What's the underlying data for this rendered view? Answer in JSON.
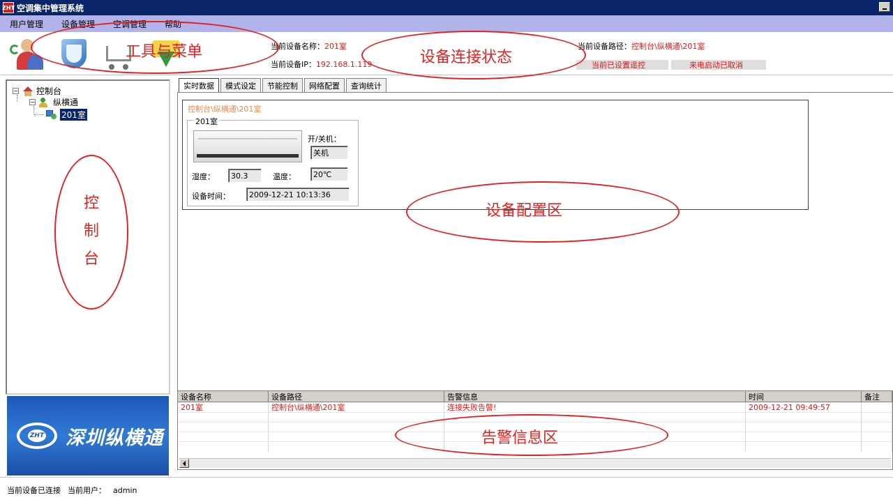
{
  "window": {
    "title": "空调集中管理系统",
    "icon_text": "ZHT"
  },
  "menu": [
    "用户管理",
    "设备管理",
    "空调管理",
    "帮助"
  ],
  "toolbar": {
    "icons": [
      "users-icon",
      "shield-icon",
      "cart-icon",
      "download-icon"
    ]
  },
  "device_info": {
    "name_label": "当前设备名称：",
    "name_value": "201室",
    "ip_label": "当前设备IP：",
    "ip_value": "192.168.1.119",
    "path_label": "当前设备路径：",
    "path_value": "控制台\\纵横通\\201室",
    "status_remote": "当前已设置遥控",
    "status_autostart": "来电启动已取消"
  },
  "tree": {
    "root": "控制台",
    "child": "纵横通",
    "leaf": "201室"
  },
  "logo": {
    "mark_text": "ZHT",
    "text": "深圳纵横通"
  },
  "tabs": [
    "实时数据",
    "模式设定",
    "节能控制",
    "网络配置",
    "查询统计"
  ],
  "device_panel": {
    "path": "控制台\\纵横通\\201室",
    "group_title": "201室",
    "power_label": "开/关机：",
    "power_value": "关机",
    "humidity_label": "湿度：",
    "humidity_value": "30.3",
    "temp_label": "温度：",
    "temp_value": "20℃",
    "time_label": "设备时间：",
    "time_value": "2009-12-21 10:13:36"
  },
  "alarm": {
    "columns": [
      "设备名称",
      "设备路径",
      "告警信息",
      "时间",
      "备注"
    ],
    "rows": [
      {
        "name": "201室",
        "path": "控制台\\纵横通\\201室",
        "message": "连接失败告警!",
        "time": "2009-12-21 09:49:57",
        "note": ""
      }
    ]
  },
  "statusbar": {
    "connection": "当前设备已连接",
    "user_label": "当前用户：",
    "user_value": "admin"
  },
  "annotations": {
    "tools_menu": "工具与菜单",
    "connection_status": "设备连接状态",
    "console_chars": [
      "控",
      "制",
      "台"
    ],
    "config_area": "设备配置区",
    "alarm_area": "告警信息区"
  },
  "colors": {
    "titlebar": "#0a246a",
    "menubar": "#b3b3ec",
    "alert_red": "#e01818",
    "annotation_red": "#e52222"
  }
}
